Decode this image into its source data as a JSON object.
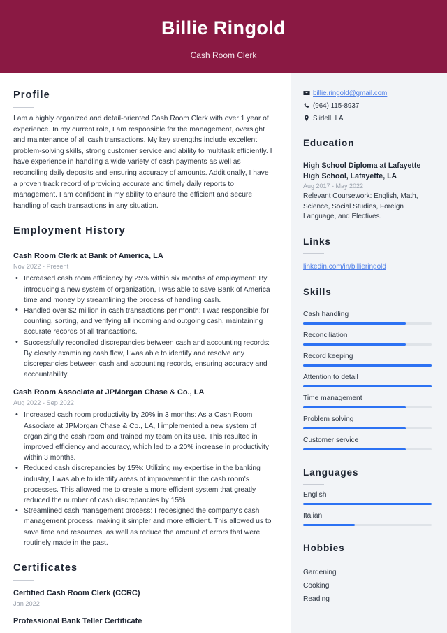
{
  "header": {
    "name": "Billie Ringold",
    "job_title": "Cash Room Clerk",
    "bg_color": "#8a1943"
  },
  "main": {
    "profile": {
      "heading": "Profile",
      "text": "I am a highly organized and detail-oriented Cash Room Clerk with over 1 year of experience. In my current role, I am responsible for the management, oversight and maintenance of all cash transactions. My key strengths include excellent problem-solving skills, strong customer service and ability to multitask efficiently. I have experience in handling a wide variety of cash payments as well as reconciling daily deposits and ensuring accuracy of amounts. Additionally, I have a proven track record of providing accurate and timely daily reports to management. I am confident in my ability to ensure the efficient and secure handling of cash transactions in any situation."
    },
    "employment": {
      "heading": "Employment History",
      "jobs": [
        {
          "title": "Cash Room Clerk at Bank of America, LA",
          "date": "Nov 2022 - Present",
          "bullets": [
            "Increased cash room efficiency by 25% within six months of employment: By introducing a new system of organization, I was able to save Bank of America time and money by streamlining the process of handling cash.",
            "Handled over $2 million in cash transactions per month: I was responsible for counting, sorting, and verifying all incoming and outgoing cash, maintaining accurate records of all transactions.",
            "Successfully reconciled discrepancies between cash and accounting records: By closely examining cash flow, I was able to identify and resolve any discrepancies between cash and accounting records, ensuring accuracy and accountability."
          ]
        },
        {
          "title": "Cash Room Associate at JPMorgan Chase & Co., LA",
          "date": "Aug 2022 - Sep 2022",
          "bullets": [
            "Increased cash room productivity by 20% in 3 months: As a Cash Room Associate at JPMorgan Chase & Co., LA, I implemented a new system of organizing the cash room and trained my team on its use. This resulted in improved efficiency and accuracy, which led to a 20% increase in productivity within 3 months.",
            "Reduced cash discrepancies by 15%: Utilizing my expertise in the banking industry, I was able to identify areas of improvement in the cash room's processes. This allowed me to create a more efficient system that greatly reduced the number of cash discrepancies by 15%.",
            "Streamlined cash management process: I redesigned the company's cash management process, making it simpler and more efficient. This allowed us to save time and resources, as well as reduce the amount of errors that were routinely made in the past."
          ]
        }
      ]
    },
    "certificates": {
      "heading": "Certificates",
      "items": [
        {
          "title": "Certified Cash Room Clerk (CCRC)",
          "date": "Jan 2022"
        },
        {
          "title": "Professional Bank Teller Certificate",
          "date": ""
        }
      ]
    }
  },
  "sidebar": {
    "contact": [
      {
        "icon": "envelope-icon",
        "text": "billie.ringold@gmail.com",
        "is_link": true
      },
      {
        "icon": "phone-icon",
        "text": "(964) 115-8937",
        "is_link": false
      },
      {
        "icon": "location-pin-icon",
        "text": "Slidell, LA",
        "is_link": false
      }
    ],
    "education": {
      "heading": "Education",
      "school": "High School Diploma at Lafayette High School, Lafayette, LA",
      "date": "Aug 2017 - May 2022",
      "description": "Relevant Coursework: English, Math, Science, Social Studies, Foreign Language, and Electives."
    },
    "links": {
      "heading": "Links",
      "items": [
        {
          "text": "linkedin.com/in/billieringold"
        }
      ]
    },
    "skills": {
      "heading": "Skills",
      "items": [
        {
          "label": "Cash handling",
          "level": 80
        },
        {
          "label": "Reconciliation",
          "level": 80
        },
        {
          "label": "Record keeping",
          "level": 100
        },
        {
          "label": "Attention to detail",
          "level": 100
        },
        {
          "label": "Time management",
          "level": 80
        },
        {
          "label": "Problem solving",
          "level": 80
        },
        {
          "label": "Customer service",
          "level": 80
        }
      ]
    },
    "languages": {
      "heading": "Languages",
      "items": [
        {
          "label": "English",
          "level": 100
        },
        {
          "label": "Italian",
          "level": 40
        }
      ]
    },
    "hobbies": {
      "heading": "Hobbies",
      "items": [
        "Gardening",
        "Cooking",
        "Reading"
      ]
    },
    "accent_color": "#2d72f3",
    "link_color": "#4f7fe8",
    "bg_color": "#f2f4f7"
  }
}
